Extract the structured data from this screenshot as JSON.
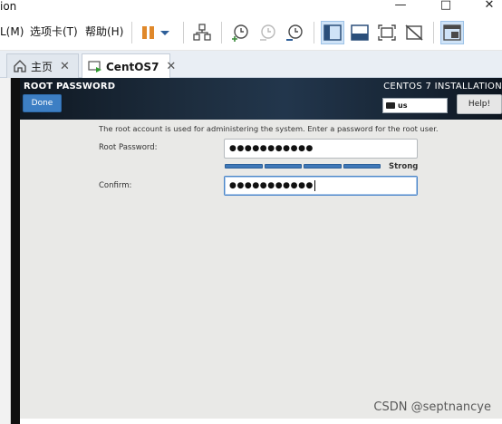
{
  "window": {
    "title_fragment": "ion",
    "controls": [
      "—",
      "□",
      "✕"
    ]
  },
  "menu": {
    "items": [
      "L(M)",
      "选项卡(T)",
      "帮助(H)"
    ]
  },
  "tabs": [
    {
      "label": "主页",
      "close": "✕",
      "active": false
    },
    {
      "label": "CentOS7",
      "close": "✕",
      "active": true
    }
  ],
  "vm": {
    "header_title": "ROOT PASSWORD",
    "done_label": "Done",
    "product": "CENTOS 7 INSTALLATION",
    "keyboard_layout": "us",
    "help_label": "Help!",
    "description": "The root account is used for administering the system.  Enter a password for the root user.",
    "root_password_label": "Root Password:",
    "root_password_value": "●●●●●●●●●●●",
    "strength_label": "Strong",
    "strength_fraction": 1.0,
    "confirm_label": "Confirm:",
    "confirm_value": "●●●●●●●●●●●"
  },
  "colors": {
    "header_bg": "#1d2d3e",
    "done_button": "#3d7fc4",
    "strength_bar": "#3f78b8",
    "focus_border": "#4b86c9"
  },
  "watermark": "CSDN @septnancye"
}
